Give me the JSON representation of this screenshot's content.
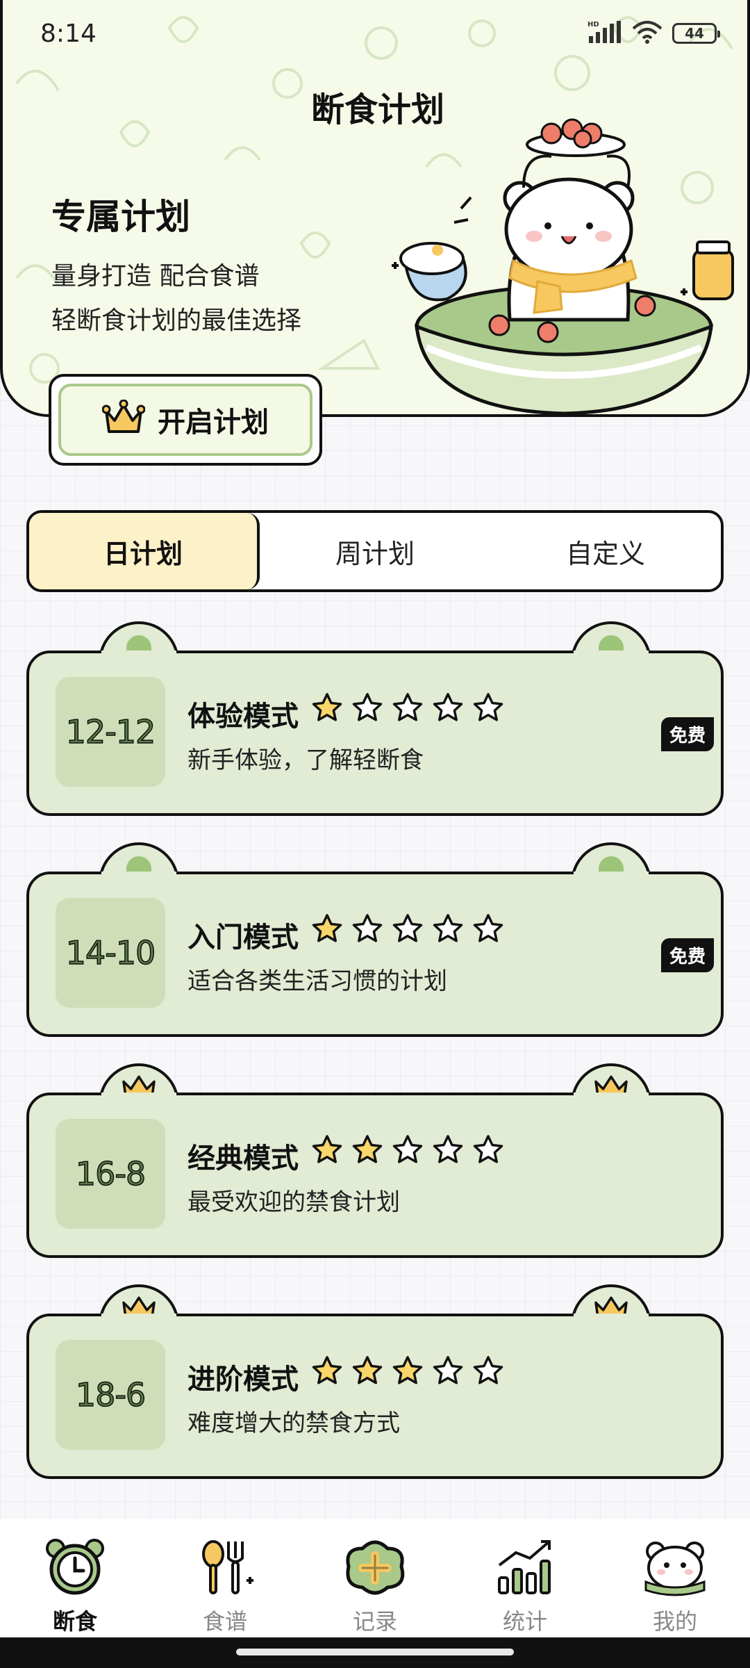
{
  "status_bar": {
    "time": "8:14",
    "network_label": "HD",
    "battery": "44"
  },
  "header": {
    "title": "断食计划",
    "promo_title": "专属计划",
    "promo_line1": "量身打造 配合食谱",
    "promo_line2": "轻断食计划的最佳选择",
    "start_button": "开启计划"
  },
  "tabs": [
    {
      "label": "日计划",
      "active": true
    },
    {
      "label": "周计划",
      "active": false
    },
    {
      "label": "自定义",
      "active": false
    }
  ],
  "plans": [
    {
      "ratio": "12-12",
      "name": "体验模式",
      "rating": 1,
      "max_rating": 5,
      "description": "新手体验，了解轻断食",
      "badge": "免费",
      "ear_icon": "dot"
    },
    {
      "ratio": "14-10",
      "name": "入门模式",
      "rating": 1,
      "max_rating": 5,
      "description": "适合各类生活习惯的计划",
      "badge": "免费",
      "ear_icon": "dot"
    },
    {
      "ratio": "16-8",
      "name": "经典模式",
      "rating": 2,
      "max_rating": 5,
      "description": "最受欢迎的禁食计划",
      "badge": "",
      "ear_icon": "crown"
    },
    {
      "ratio": "18-6",
      "name": "进阶模式",
      "rating": 3,
      "max_rating": 5,
      "description": "难度增大的禁食方式",
      "badge": "",
      "ear_icon": "crown"
    }
  ],
  "bottom_nav": [
    {
      "label": "断食",
      "icon": "alarm-clock-icon",
      "active": true
    },
    {
      "label": "食谱",
      "icon": "spoon-fork-icon",
      "active": false
    },
    {
      "label": "记录",
      "icon": "add-record-icon",
      "active": false
    },
    {
      "label": "统计",
      "icon": "chart-icon",
      "active": false
    },
    {
      "label": "我的",
      "icon": "bear-avatar-icon",
      "active": false
    }
  ],
  "colors": {
    "header_bg": "#f6fbe9",
    "card_bg": "#e2ebd3",
    "ratio_bg": "#cfdeb8",
    "active_tab": "#fdf1c7",
    "star_fill": "#f8d66a",
    "accent_green": "#9cc57a"
  }
}
